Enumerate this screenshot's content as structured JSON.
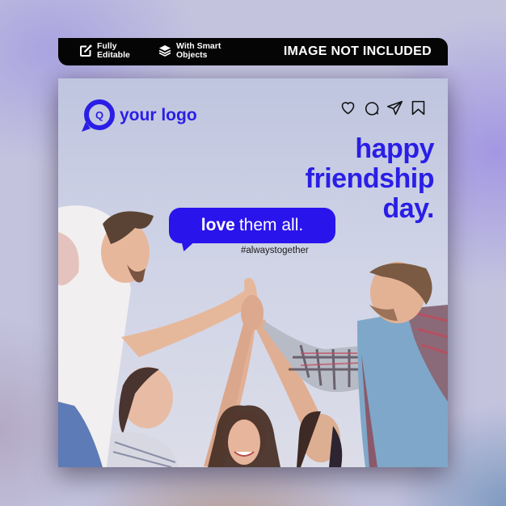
{
  "banner": {
    "features": [
      {
        "icon": "edit-icon",
        "line1": "Fully",
        "line2": "Editable"
      },
      {
        "icon": "layers-icon",
        "line1": "With Smart",
        "line2": "Objects"
      }
    ],
    "notice": "IMAGE NOT INCLUDED"
  },
  "post": {
    "logo": {
      "letter": "Q",
      "text": "your logo"
    },
    "social_icons": [
      "heart-icon",
      "comment-icon",
      "send-icon",
      "bookmark-icon"
    ],
    "headline": {
      "line1": "happy",
      "line2": "friendship",
      "line3": "day."
    },
    "bubble": {
      "bold": "love",
      "regular": "them all."
    },
    "hashtag": "#alwaystogether",
    "photo_description": "Group of five friends joining raised hands in a high-five against a pale sky"
  },
  "colors": {
    "brand_blue": "#2a1ee6",
    "bubble_blue": "#2a14ec",
    "banner_bg": "#050505"
  }
}
